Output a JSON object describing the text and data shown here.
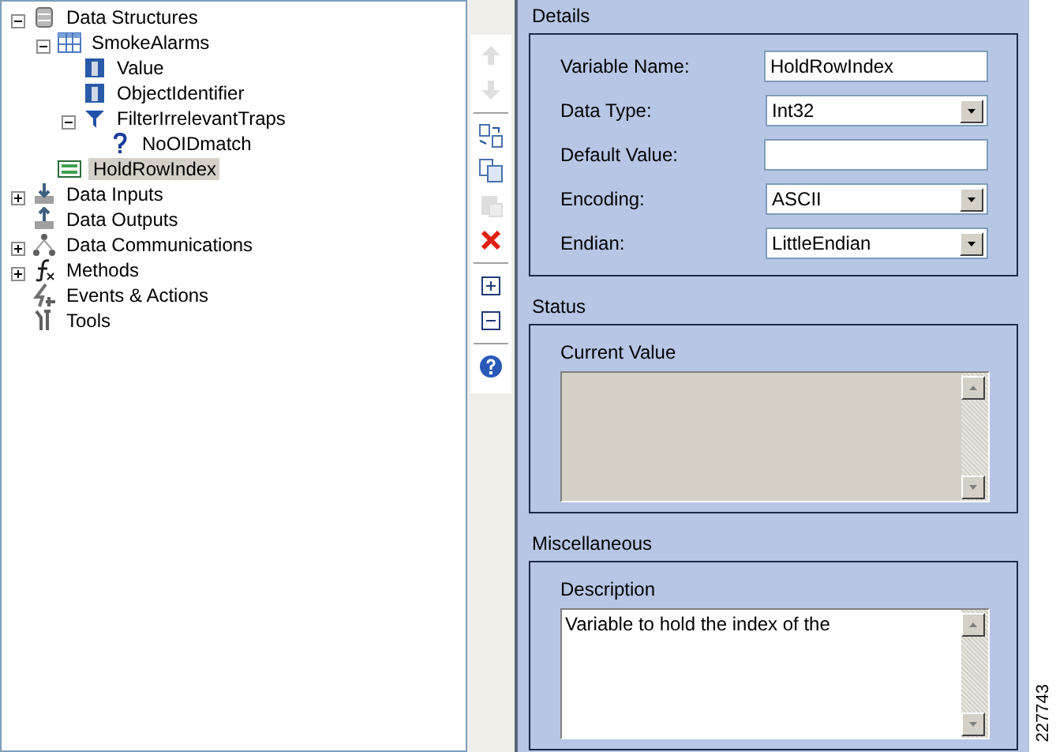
{
  "tree": [
    {
      "label": "Data Structures",
      "kind": "storage",
      "expanded": true,
      "selected": false,
      "children": [
        {
          "label": "SmokeAlarms",
          "kind": "table",
          "expanded": true,
          "selected": false,
          "children": [
            {
              "label": "Value",
              "kind": "column",
              "selected": false
            },
            {
              "label": "ObjectIdentifier",
              "kind": "column",
              "selected": false
            },
            {
              "label": "FilterIrrelevantTraps",
              "kind": "filter",
              "expanded": true,
              "selected": false,
              "children": [
                {
                  "label": "NoOIDmatch",
                  "kind": "question",
                  "selected": false
                }
              ]
            }
          ]
        },
        {
          "label": "HoldRowIndex",
          "kind": "variable",
          "selected": true
        }
      ]
    },
    {
      "label": "Data Inputs",
      "kind": "input",
      "expanded": false,
      "selected": false
    },
    {
      "label": "Data Outputs",
      "kind": "output",
      "selected": false
    },
    {
      "label": "Data Communications",
      "kind": "network",
      "expanded": false,
      "selected": false
    },
    {
      "label": "Methods",
      "kind": "function",
      "expanded": false,
      "selected": false
    },
    {
      "label": "Events & Actions",
      "kind": "events",
      "selected": false
    },
    {
      "label": "Tools",
      "kind": "tools",
      "selected": false
    }
  ],
  "toolbar": [
    {
      "kind": "up",
      "disabled": true
    },
    {
      "kind": "down",
      "disabled": true
    },
    {
      "kind": "separator"
    },
    {
      "kind": "swap",
      "disabled": false
    },
    {
      "kind": "copy",
      "disabled": false
    },
    {
      "kind": "paste",
      "disabled": true
    },
    {
      "kind": "delete",
      "disabled": false
    },
    {
      "kind": "separator"
    },
    {
      "kind": "expand",
      "disabled": false
    },
    {
      "kind": "collapse",
      "disabled": false
    },
    {
      "kind": "separator"
    },
    {
      "kind": "help",
      "disabled": false
    }
  ],
  "details": {
    "title": "Details",
    "fields": [
      {
        "label": "Variable Name:",
        "kind": "text",
        "value": "HoldRowIndex"
      },
      {
        "label": "Data Type:",
        "kind": "select",
        "value": "Int32"
      },
      {
        "label": "Default Value:",
        "kind": "text"
      },
      {
        "label": "Encoding:",
        "kind": "select",
        "value": "ASCII"
      },
      {
        "label": "Endian:",
        "kind": "select",
        "value": "LittleEndian"
      }
    ]
  },
  "status": {
    "title": "Status",
    "label": "Current Value",
    "disabled": true
  },
  "miscellaneous": {
    "title": "Miscellaneous",
    "label": "Description",
    "value": "Variable to hold the index of the",
    "disabled": false
  },
  "figure_number": "227743"
}
